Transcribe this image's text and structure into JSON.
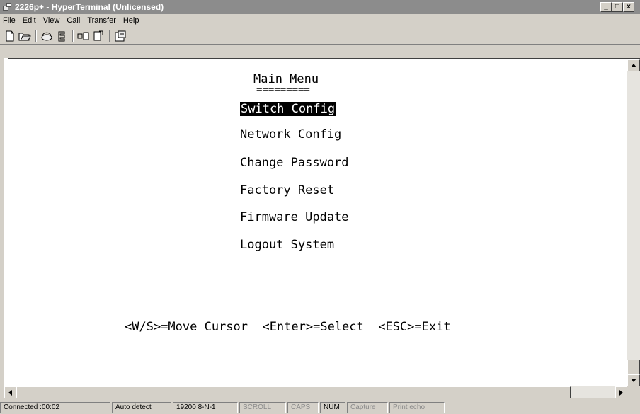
{
  "window": {
    "title": "2226p+ - HyperTerminal (Unlicensed)",
    "controls": [
      "_",
      "□",
      "x"
    ]
  },
  "menubar": [
    "File",
    "Edit",
    "View",
    "Call",
    "Transfer",
    "Help"
  ],
  "toolbar": {
    "icons": [
      "new-icon",
      "open-icon",
      "disconnect-icon",
      "dial-icon",
      "send-icon",
      "receive-icon",
      "properties-icon"
    ]
  },
  "terminal": {
    "heading": "Main Menu",
    "underline": "=========",
    "menu_items": [
      {
        "label": "Switch Config",
        "selected": true
      },
      {
        "label": "Network Config",
        "selected": false
      },
      {
        "label": "Change Password",
        "selected": false
      },
      {
        "label": "Factory Reset",
        "selected": false
      },
      {
        "label": "Firmware Update",
        "selected": false
      },
      {
        "label": "Logout System",
        "selected": false
      }
    ],
    "help_line": "<W/S>=Move Cursor  <Enter>=Select  <ESC>=Exit"
  },
  "statusbar": {
    "connected": "Connected :00:02",
    "detect": "Auto detect",
    "settings": "19200 8-N-1",
    "scroll": "SCROLL",
    "caps": "CAPS",
    "num": "NUM",
    "capture": "Capture",
    "print_echo": "Print echo"
  }
}
